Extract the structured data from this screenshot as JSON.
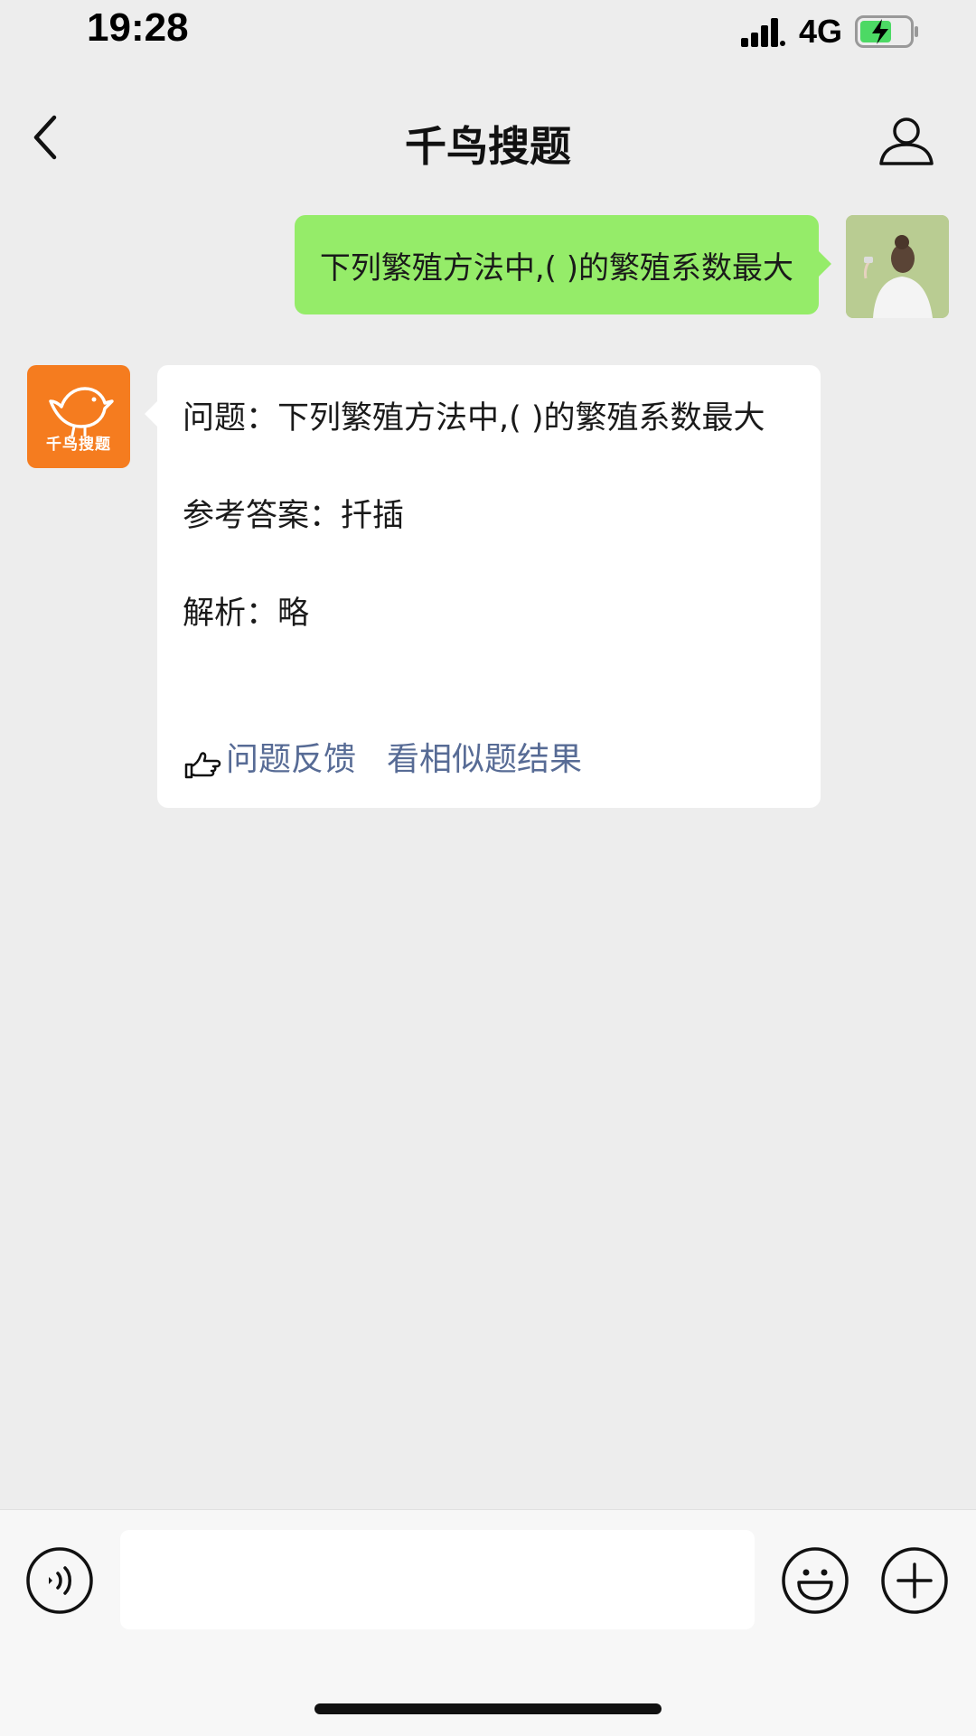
{
  "status_bar": {
    "time": "19:28",
    "network": "4G",
    "icons": [
      "signal-icon",
      "battery-charging-icon"
    ]
  },
  "nav": {
    "title": "千鸟搜题",
    "icons": [
      "back-chevron-icon",
      "profile-icon"
    ]
  },
  "messages": {
    "sent": {
      "text": "下列繁殖方法中,(      )的繁殖系数最大"
    },
    "received": {
      "avatar_label": "千鸟搜题",
      "question": "问题：下列繁殖方法中,(      )的繁殖系数最大",
      "answer": "参考答案：扦插",
      "analysis": "解析：略",
      "feedback_link": "问题反馈",
      "similar_link": "看相似题结果",
      "icons": [
        "pointing-hand-icon",
        "bird-logo-icon"
      ]
    }
  },
  "input_bar": {
    "value": "",
    "icons": [
      "voice-icon",
      "emoji-icon",
      "plus-icon"
    ]
  },
  "colors": {
    "sent_bubble": "#95ec69",
    "link": "#576b95",
    "bot_avatar": "#f57c1f",
    "background": "#ededed"
  }
}
